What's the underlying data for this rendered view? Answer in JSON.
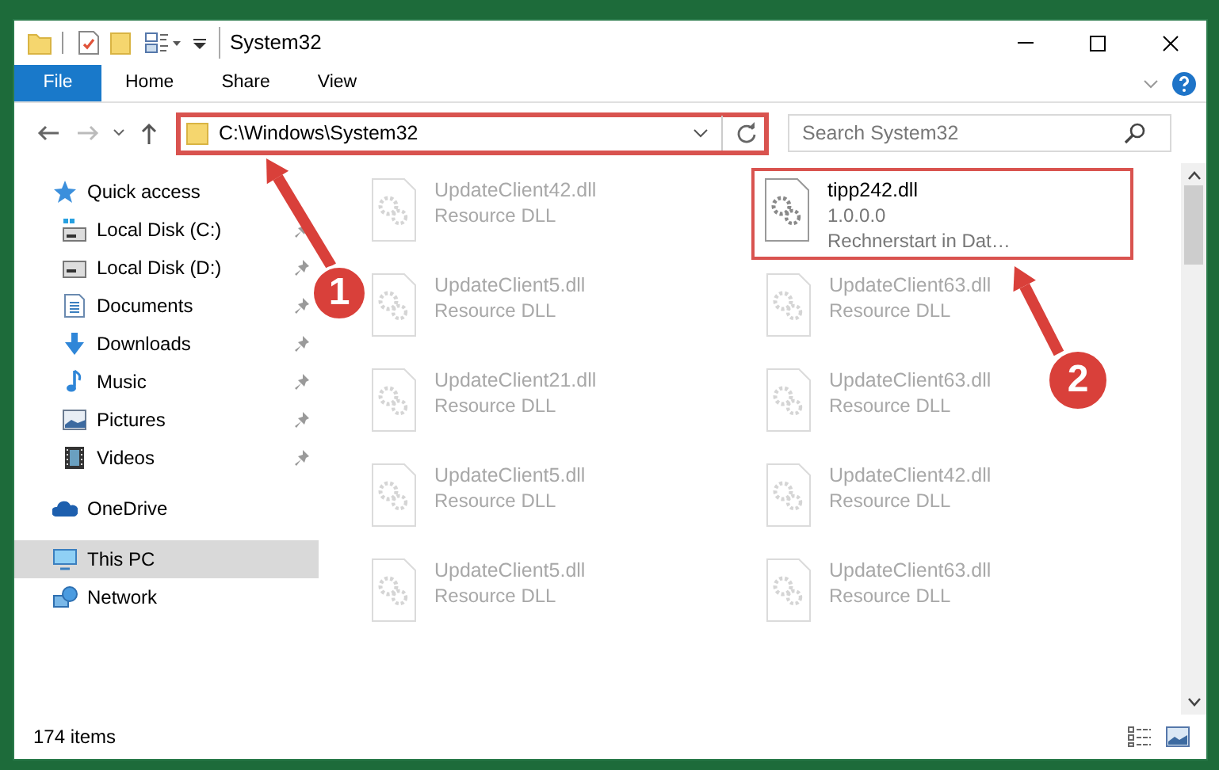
{
  "window": {
    "title": "System32"
  },
  "ribbon": {
    "tabs": [
      {
        "label": "File",
        "kind": "file"
      },
      {
        "label": "Home",
        "kind": "tab"
      },
      {
        "label": "Share",
        "kind": "tab"
      },
      {
        "label": "View",
        "kind": "tab"
      }
    ]
  },
  "address": {
    "path": "C:\\Windows\\System32",
    "highlighted": true
  },
  "search": {
    "placeholder": "Search System32"
  },
  "nav": {
    "items": [
      {
        "label": "Quick access",
        "selected": false,
        "children": [
          {
            "label": "Local Disk (C:)",
            "pinned": true
          },
          {
            "label": "Local Disk (D:)",
            "pinned": true
          },
          {
            "label": "Documents",
            "pinned": true
          },
          {
            "label": "Downloads",
            "pinned": true
          },
          {
            "label": "Music",
            "pinned": true
          },
          {
            "label": "Pictures",
            "pinned": true
          },
          {
            "label": "Videos",
            "pinned": true
          }
        ]
      },
      {
        "label": "OneDrive",
        "selected": false
      },
      {
        "label": "This PC",
        "selected": true
      },
      {
        "label": "Network",
        "selected": false
      }
    ]
  },
  "files": [
    {
      "name": "UpdateClient42.dll",
      "details": [
        "Resource DLL"
      ],
      "dimmed": true,
      "highlighted": false
    },
    {
      "name": "tipp242.dll",
      "details": [
        "1.0.0.0",
        "Rechnerstart in Dat…"
      ],
      "dimmed": false,
      "highlighted": true
    },
    {
      "name": "UpdateClient5.dll",
      "details": [
        "Resource DLL"
      ],
      "dimmed": true,
      "highlighted": false
    },
    {
      "name": "UpdateClient63.dll",
      "details": [
        "Resource DLL"
      ],
      "dimmed": true,
      "highlighted": false
    },
    {
      "name": "UpdateClient21.dll",
      "details": [
        "Resource DLL"
      ],
      "dimmed": true,
      "highlighted": false
    },
    {
      "name": "UpdateClient63.dll",
      "details": [
        "Resource DLL"
      ],
      "dimmed": true,
      "highlighted": false
    },
    {
      "name": "UpdateClient5.dll",
      "details": [
        "Resource DLL"
      ],
      "dimmed": true,
      "highlighted": false
    },
    {
      "name": "UpdateClient42.dll",
      "details": [
        "Resource DLL"
      ],
      "dimmed": true,
      "highlighted": false
    },
    {
      "name": "UpdateClient5.dll",
      "details": [
        "Resource DLL"
      ],
      "dimmed": true,
      "highlighted": false
    },
    {
      "name": "UpdateClient63.dll",
      "details": [
        "Resource DLL"
      ],
      "dimmed": true,
      "highlighted": false
    }
  ],
  "status_bar": {
    "text": "174 items"
  },
  "annotations": [
    {
      "label": "1"
    },
    {
      "label": "2"
    }
  ]
}
